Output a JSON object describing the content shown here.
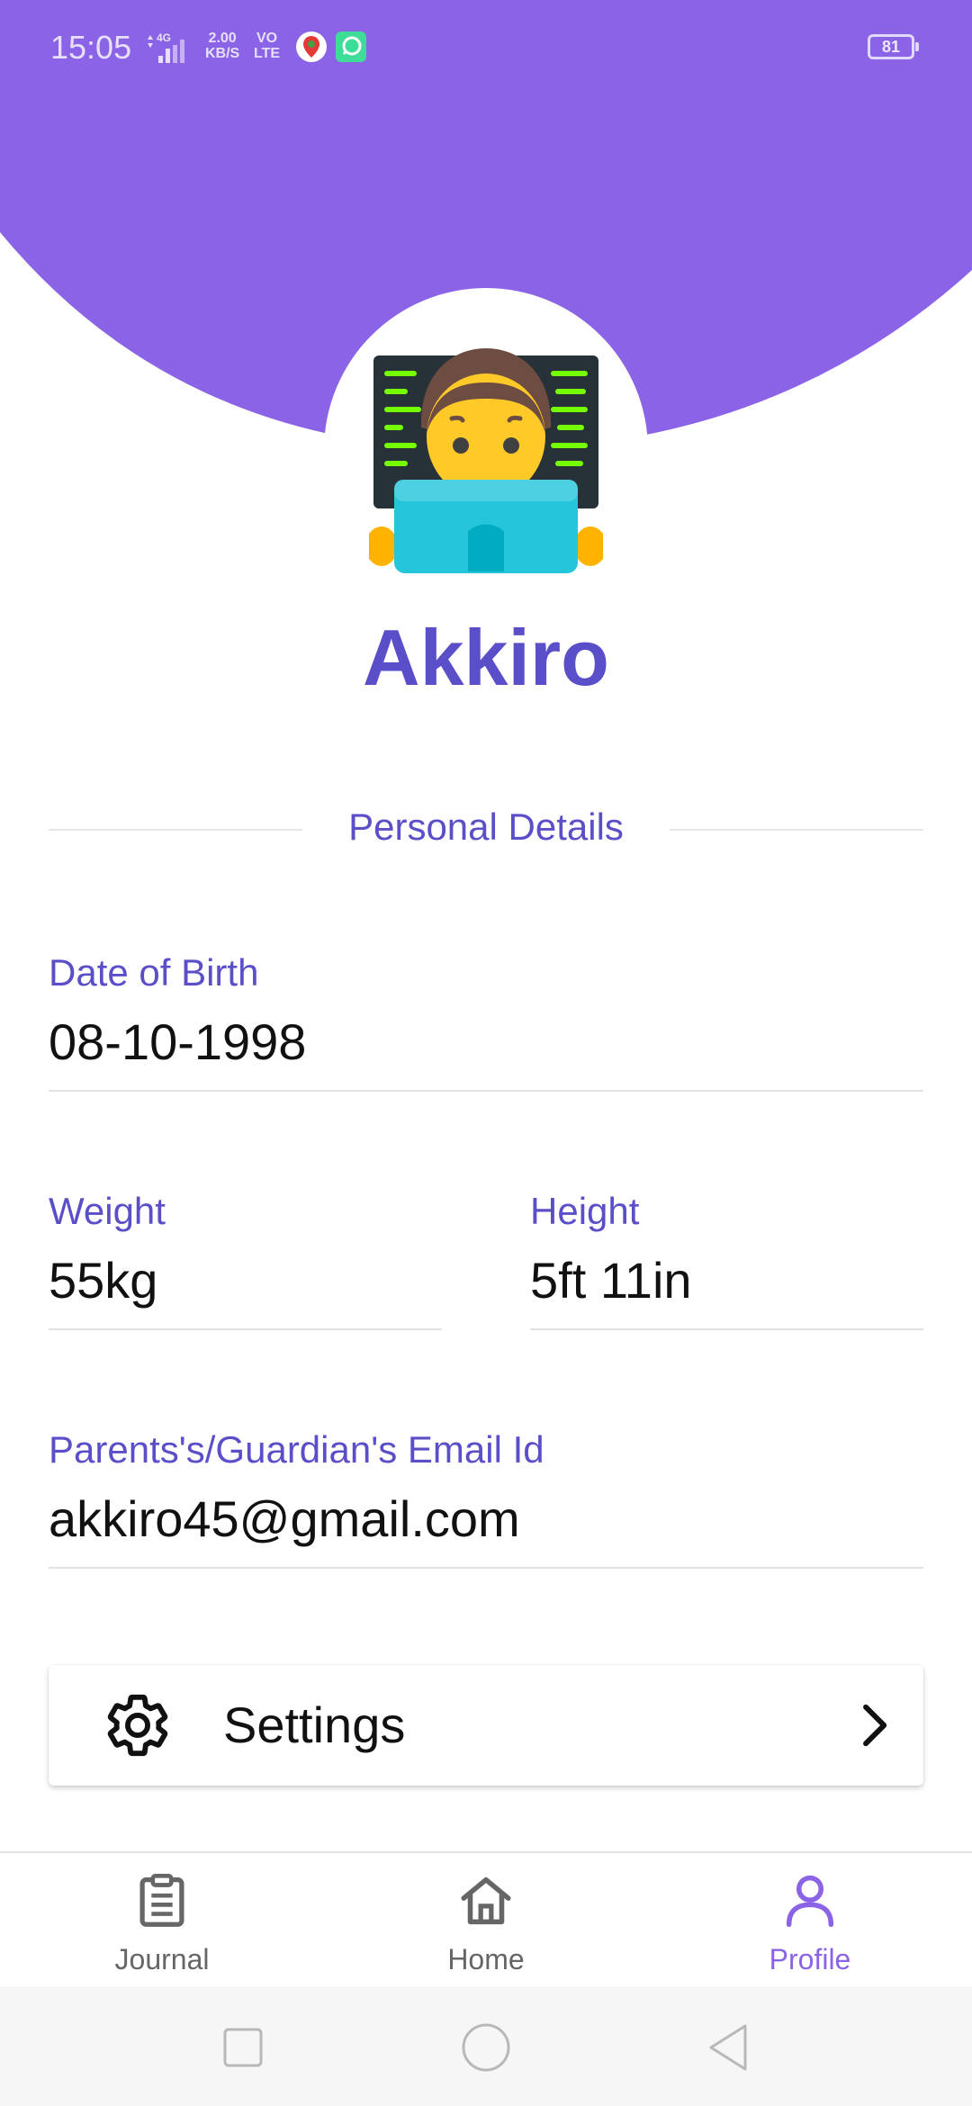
{
  "status_bar": {
    "time": "15:05",
    "network_type": "4G",
    "net_speed_value": "2.00",
    "net_speed_unit": "KB/S",
    "volte_top": "VO",
    "volte_bottom": "LTE",
    "battery": "81"
  },
  "profile": {
    "name": "Akkiro",
    "avatar_icon": "technologist-emoji-icon"
  },
  "section": {
    "title": "Personal Details"
  },
  "fields": {
    "dob": {
      "label": "Date of Birth",
      "value": "08-10-1998"
    },
    "weight": {
      "label": "Weight",
      "value": "55kg"
    },
    "height": {
      "label": "Height",
      "value": "5ft 11in"
    },
    "email": {
      "label": "Parents's/Guardian's Email Id",
      "value": "akkiro45@gmail.com"
    }
  },
  "settings": {
    "label": "Settings",
    "icon": "gear-icon"
  },
  "bottom_nav": {
    "items": [
      {
        "label": "Journal",
        "icon": "clipboard-icon"
      },
      {
        "label": "Home",
        "icon": "home-icon"
      },
      {
        "label": "Profile",
        "icon": "person-icon",
        "active": true
      }
    ]
  },
  "colors": {
    "header": "#8b63e6",
    "accent": "#5b4fc9",
    "active_nav": "#8b63e6"
  }
}
